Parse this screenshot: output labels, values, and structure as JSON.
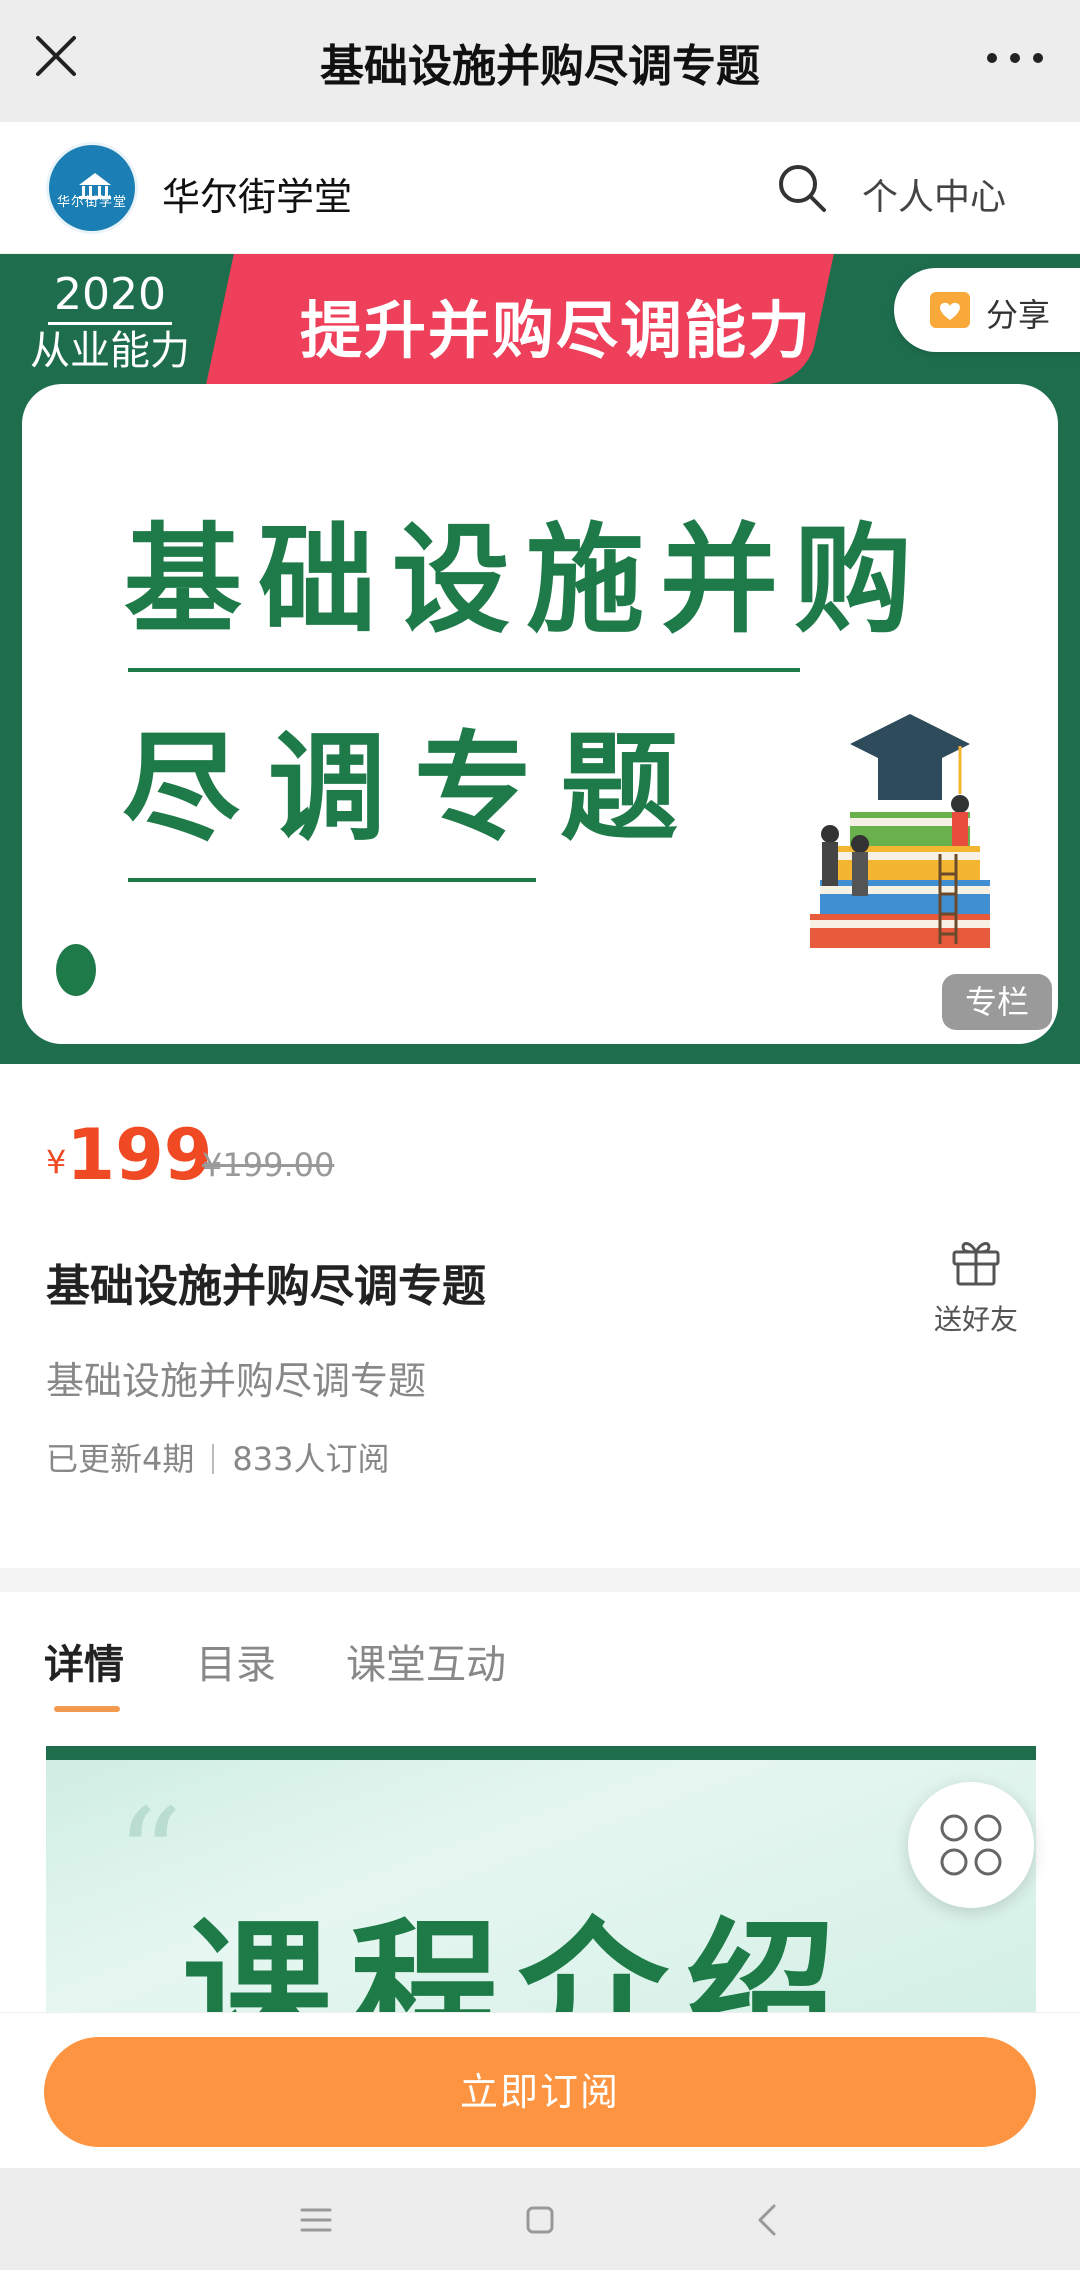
{
  "topbar": {
    "title": "基础设施并购尽调专题"
  },
  "shop": {
    "name": "华尔街学堂",
    "logo_text": "华尔街学堂",
    "user_center": "个人中心"
  },
  "hero": {
    "year": "2020",
    "year_sub": "从业能力",
    "ribbon": "提升并购尽调能力",
    "line1": "基础设施并购",
    "line2": "尽调专题",
    "share": "分享",
    "tag": "专栏"
  },
  "product": {
    "currency": "¥",
    "price": "199",
    "original_price": "¥199.00",
    "title": "基础设施并购尽调专题",
    "subtitle": "基础设施并购尽调专题",
    "updated": "已更新4期",
    "subscribers": "833人订阅",
    "gift_label": "送好友"
  },
  "tabs": [
    {
      "label": "详情",
      "active": true
    },
    {
      "label": "目录",
      "active": false
    },
    {
      "label": "课堂互动",
      "active": false
    }
  ],
  "intro": {
    "quote": "“",
    "headline": "课程介绍"
  },
  "cta": {
    "subscribe": "立即订阅"
  },
  "colors": {
    "accent": "#fd9441",
    "price": "#f04a24",
    "brand_green": "#1e6e4e",
    "ribbon": "#ee3f5b"
  }
}
